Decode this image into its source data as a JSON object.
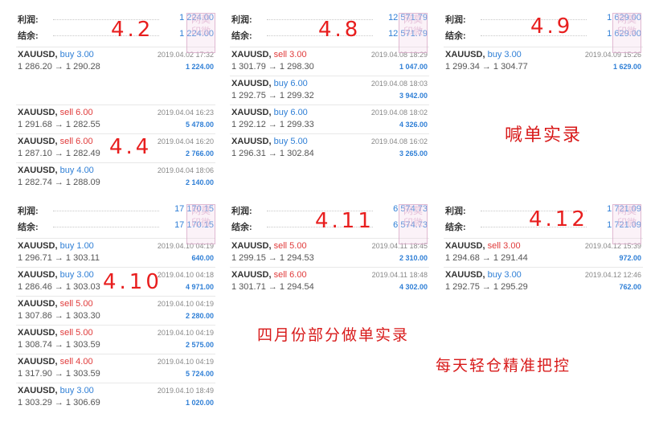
{
  "labels": {
    "profit": "利润:",
    "balance": "结余:"
  },
  "colors": {
    "buy": "#2f7fd6",
    "sell": "#e03a3a",
    "profit": "#2f7fd6",
    "annotation": "#e81e1e"
  },
  "panels": [
    {
      "id": "p1",
      "annotation": "4.2",
      "profit": "1 224.00",
      "balance": "1 224.00",
      "trades": [
        {
          "symbol": "XAUUSD,",
          "side": "buy",
          "vol": "3.00",
          "prices": "1 286.20 → 1 290.28",
          "date": "2019.04.02 17:32",
          "profit": "1 224.00"
        }
      ]
    },
    {
      "id": "p2",
      "annotation": "4.4",
      "trades": [
        {
          "symbol": "XAUUSD,",
          "side": "sell",
          "vol": "6.00",
          "prices": "1 291.68 → 1 282.55",
          "date": "2019.04.04 16:23",
          "profit": "5 478.00"
        },
        {
          "symbol": "XAUUSD,",
          "side": "sell",
          "vol": "6.00",
          "prices": "1 287.10 → 1 282.49",
          "date": "2019.04.04 16:20",
          "profit": "2 766.00"
        },
        {
          "symbol": "XAUUSD,",
          "side": "buy",
          "vol": "4.00",
          "prices": "1 282.74 → 1 288.09",
          "date": "2019.04.04 18:06",
          "profit": "2 140.00"
        }
      ]
    },
    {
      "id": "p3",
      "annotation": "4.8",
      "profit": "12 571.79",
      "balance": "12 571.79",
      "trades": [
        {
          "symbol": "XAUUSD,",
          "side": "sell",
          "vol": "3.00",
          "prices": "1 301.79 → 1 298.30",
          "date": "2019.04.08 18:29",
          "profit": "1 047.00"
        },
        {
          "symbol": "XAUUSD,",
          "side": "buy",
          "vol": "6.00",
          "prices": "1 292.75 → 1 299.32",
          "date": "2019.04.08 18:03",
          "profit": "3 942.00"
        },
        {
          "symbol": "XAUUSD,",
          "side": "buy",
          "vol": "6.00",
          "prices": "1 292.12 → 1 299.33",
          "date": "2019.04.08 18:02",
          "profit": "4 326.00"
        },
        {
          "symbol": "XAUUSD,",
          "side": "buy",
          "vol": "5.00",
          "prices": "1 296.31 → 1 302.84",
          "date": "2019.04.08 16:02",
          "profit": "3 265.00"
        }
      ]
    },
    {
      "id": "p4",
      "annotation": "4.9",
      "profit": "1 629.00",
      "balance": "1 629.00",
      "trades": [
        {
          "symbol": "XAUUSD,",
          "side": "buy",
          "vol": "3.00",
          "prices": "1 299.34 → 1 304.77",
          "date": "2019.04.09 15:26",
          "profit": "1 629.00"
        }
      ]
    },
    {
      "id": "p5",
      "annotation": "4.10",
      "profit": "17 170.15",
      "balance": "17 170.15",
      "trades": [
        {
          "symbol": "XAUUSD,",
          "side": "buy",
          "vol": "1.00",
          "prices": "1 296.71 → 1 303.11",
          "date": "2019.04.10 04:19",
          "profit": "640.00"
        },
        {
          "symbol": "XAUUSD,",
          "side": "buy",
          "vol": "3.00",
          "prices": "1 286.46 → 1 303.03",
          "date": "2019.04.10 04:18",
          "profit": "4 971.00"
        },
        {
          "symbol": "XAUUSD,",
          "side": "sell",
          "vol": "5.00",
          "prices": "1 307.86 → 1 303.30",
          "date": "2019.04.10 04:19",
          "profit": "2 280.00"
        },
        {
          "symbol": "XAUUSD,",
          "side": "sell",
          "vol": "5.00",
          "prices": "1 308.74 → 1 303.59",
          "date": "2019.04.10 04:19",
          "profit": "2 575.00"
        },
        {
          "symbol": "XAUUSD,",
          "side": "sell",
          "vol": "4.00",
          "prices": "1 317.90 → 1 303.59",
          "date": "2019.04.10 04:19",
          "profit": "5 724.00"
        },
        {
          "symbol": "XAUUSD,",
          "side": "buy",
          "vol": "3.00",
          "prices": "1 303.29 → 1 306.69",
          "date": "2019.04.10 18:49",
          "profit": "1 020.00"
        }
      ]
    },
    {
      "id": "p6",
      "annotation": "4.11",
      "profit": "6 574.73",
      "balance": "6 574.73",
      "trades": [
        {
          "symbol": "XAUUSD,",
          "side": "sell",
          "vol": "5.00",
          "prices": "1 299.15 → 1 294.53",
          "date": "2019.04.11 18:45",
          "profit": "2 310.00"
        },
        {
          "symbol": "XAUUSD,",
          "side": "sell",
          "vol": "6.00",
          "prices": "1 301.71 → 1 294.54",
          "date": "2019.04.11 18:48",
          "profit": "4 302.00"
        }
      ]
    },
    {
      "id": "p7",
      "annotation": "4.12",
      "profit": "1 721.09",
      "balance": "1 721.09",
      "trades": [
        {
          "symbol": "XAUUSD,",
          "side": "sell",
          "vol": "3.00",
          "prices": "1 294.68 → 1 291.44",
          "date": "2019.04.12 15:39",
          "profit": "972.00"
        },
        {
          "symbol": "XAUUSD,",
          "side": "buy",
          "vol": "3.00",
          "prices": "1 292.75 → 1 295.29",
          "date": "2019.04.12 12:46",
          "profit": "762.00"
        }
      ]
    }
  ],
  "captions": {
    "call_live": "喊单实录",
    "april_partial": "四月份部分做单实录",
    "daily_control": "每天轻仓精准把控"
  },
  "stamp_text": "网莫印微"
}
